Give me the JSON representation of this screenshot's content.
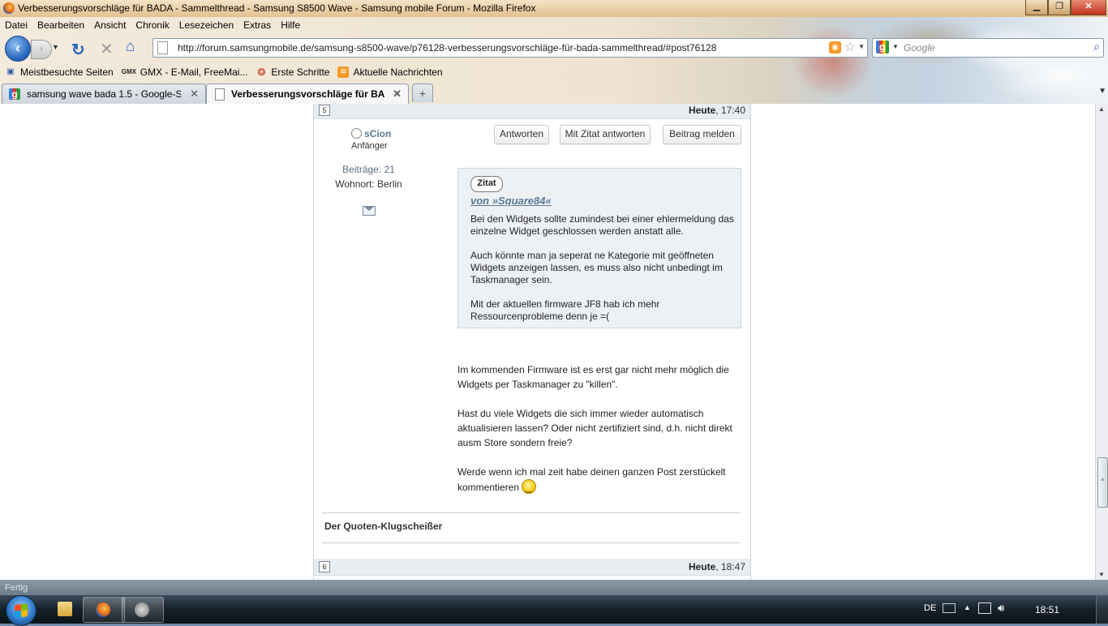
{
  "window": {
    "title": "Verbesserungsvorschläge für BADA - Sammelthread - Samsung S8500 Wave - Samsung mobile Forum - Mozilla Firefox",
    "min": "▁",
    "max": "❐",
    "close": "✕"
  },
  "menu": [
    "Datei",
    "Bearbeiten",
    "Ansicht",
    "Chronik",
    "Lesezeichen",
    "Extras",
    "Hilfe"
  ],
  "nav": {
    "url": "http://forum.samsungmobile.de/samsung-s8500-wave/p76128-verbesserungsvorschläge-für-bada-sammelthread/#post76128",
    "search_placeholder": "Google"
  },
  "bookmarks": [
    {
      "label": "Meistbesuchte Seiten",
      "icon": "bookmark-icon"
    },
    {
      "label": "GMX - E-Mail, FreeMai...",
      "icon": "gmx-icon"
    },
    {
      "label": "Erste Schritte",
      "icon": "firefox-icon"
    },
    {
      "label": "Aktuelle Nachrichten",
      "icon": "rss-icon"
    }
  ],
  "tabs": [
    {
      "label": "samsung wave bada 1.5 - Google-S...",
      "active": false
    },
    {
      "label": "Verbesserungsvorschläge für BA...",
      "active": true
    }
  ],
  "post": {
    "prev_number": "5",
    "prev_date_day": "Heute",
    "prev_date_time": ", 17:40",
    "user": {
      "name": "sCion",
      "rank": "Anfänger",
      "posts": "Beiträge: 21",
      "location": "Wohnort: Berlin"
    },
    "buttons": {
      "reply": "Antworten",
      "quote_reply": "Mit Zitat antworten",
      "report": "Beitrag melden"
    },
    "quote": {
      "badge": "Zitat",
      "author": "von »Square84«",
      "paragraphs": [
        "Bei den Widgets sollte zumindest bei einer ehlermeldung das einzelne Widget geschlossen werden anstatt alle.",
        "Auch könnte man ja seperat ne Kategorie mit geöffneten Widgets anzeigen lassen, es muss also nicht unbedingt im Taskmanager sein.",
        "Mit der aktuellen firmware JF8 hab ich mehr Ressourcenprobleme denn je =("
      ]
    },
    "body": [
      "Im kommenden Firmware ist es erst gar nicht mehr möglich die Widgets per Taskmanager zu \"killen\".",
      "Hast du viele Widgets die sich immer wieder automatisch aktualisieren lassen? Oder nicht zertifiziert sind, d.h. nicht direkt ausm Store sondern freie?",
      "Werde wenn ich mal zeit habe deinen ganzen Post zerstückelt kommentieren"
    ],
    "signature": "Der Quoten-Klugscheißer",
    "next_number": "6",
    "next_date_day": "Heute",
    "next_date_time": ", 18:47"
  },
  "status": "Fertig",
  "taskbar": {
    "lang": "DE",
    "clock": "18:51"
  }
}
